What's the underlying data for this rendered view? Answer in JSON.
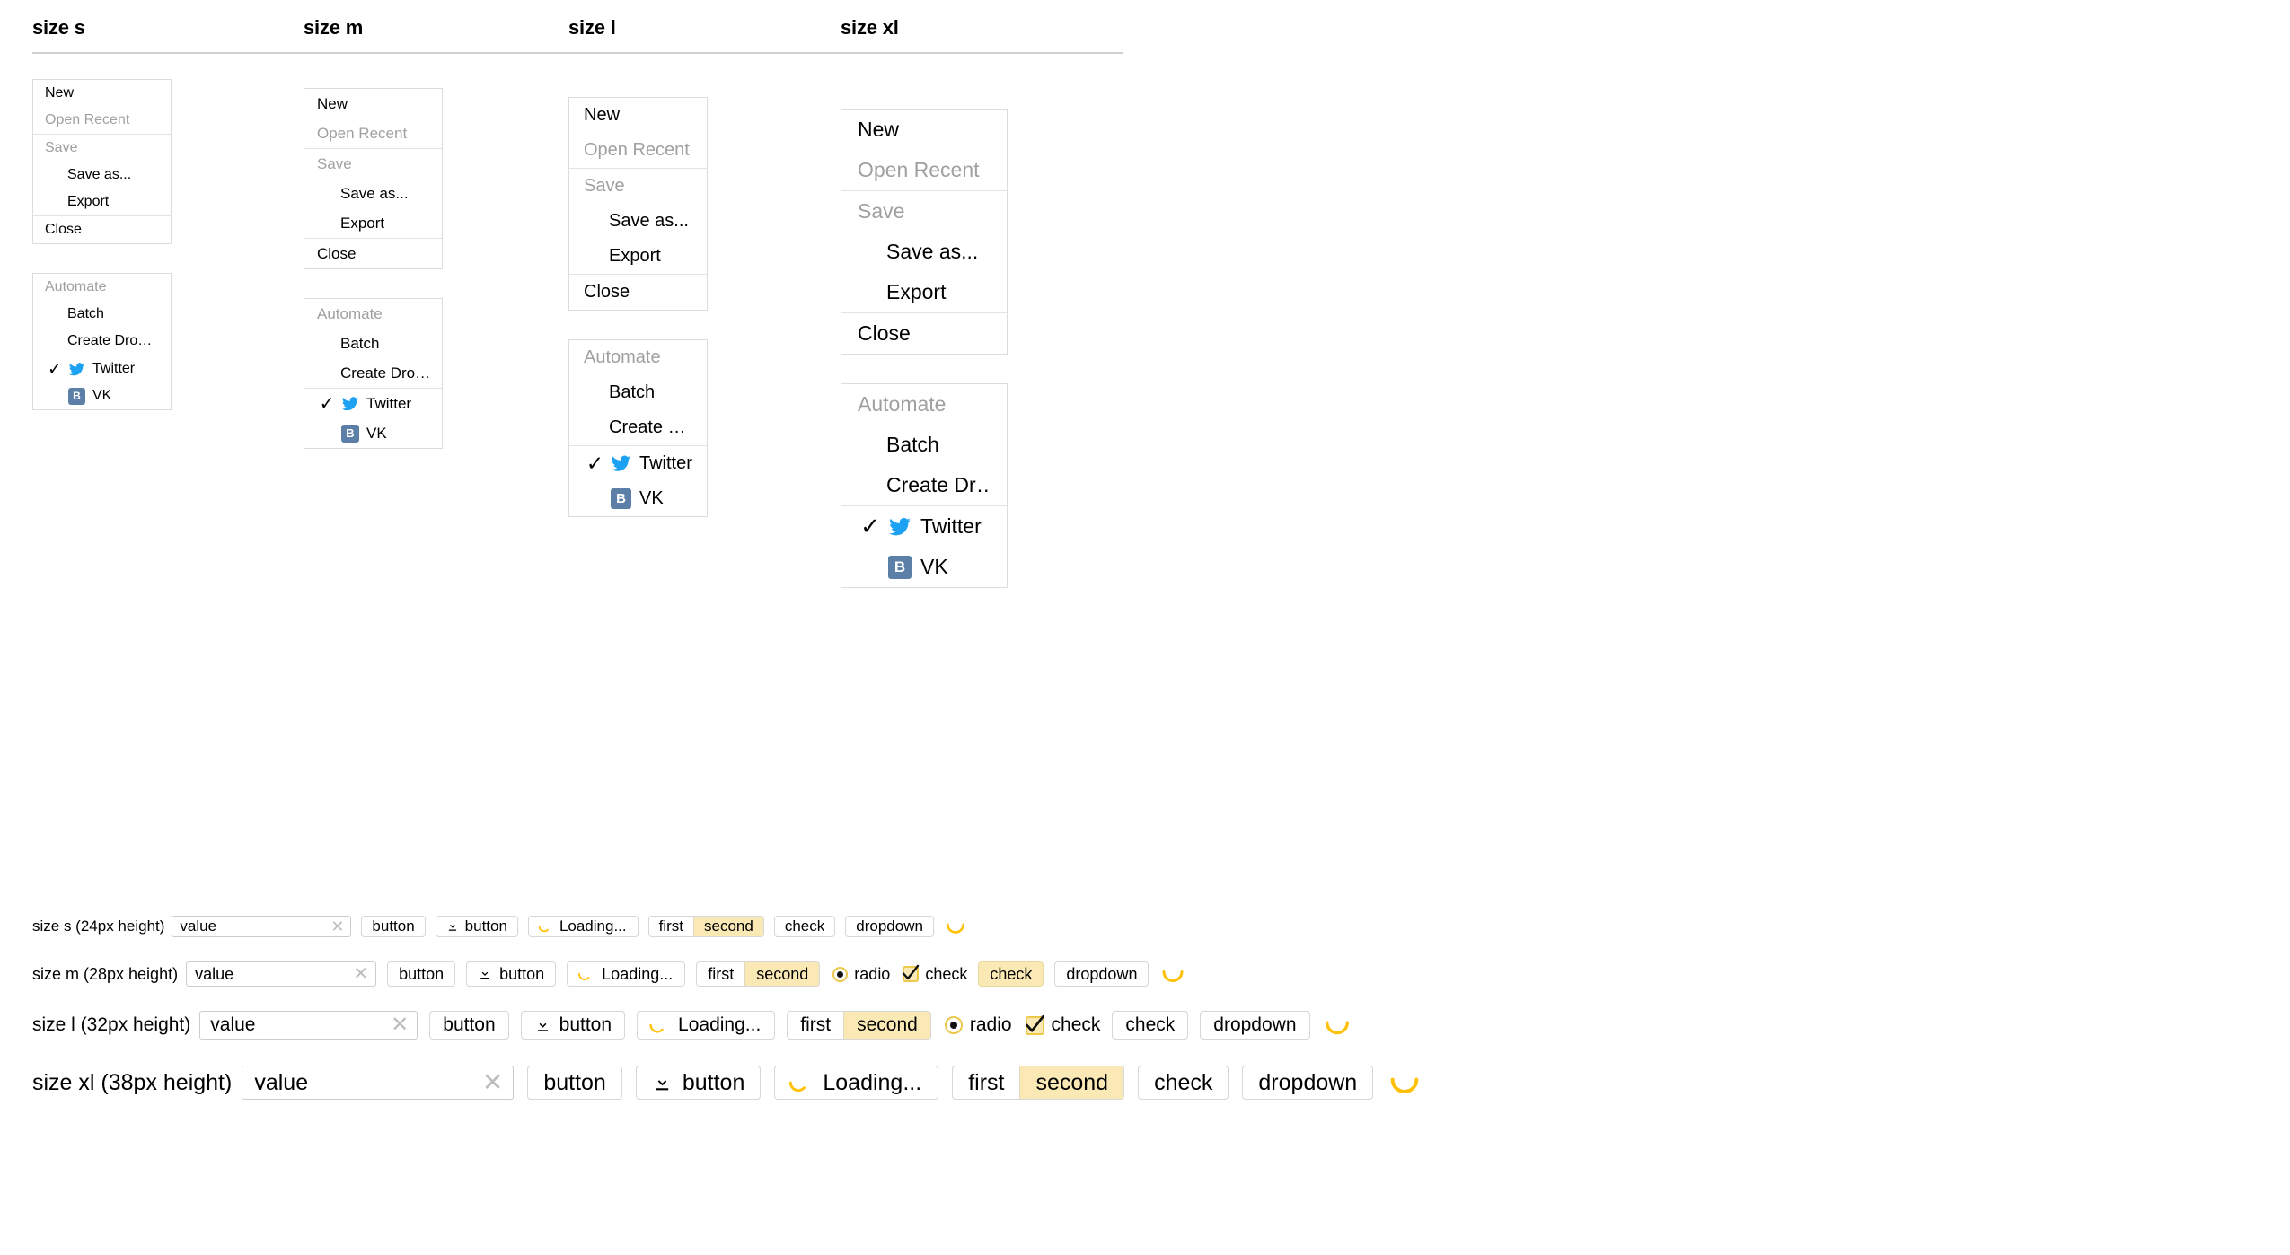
{
  "headers": [
    {
      "label": "size s"
    },
    {
      "label": "size m"
    },
    {
      "label": "size l"
    },
    {
      "label": "size xl"
    }
  ],
  "colors": {
    "accent_yellow": "#fae9b4",
    "accent_border": "#ecc94b",
    "spinner": "#ffc107",
    "twitter_blue": "#1da1f2",
    "vk_blue": "#5b7fa6",
    "muted_text": "#a0a0a0",
    "border_grey": "#dcdcdc"
  },
  "menus": {
    "file_group_1": [
      {
        "label": "New",
        "state": "normal",
        "indent": 0
      },
      {
        "label": "Open Recent",
        "state": "muted",
        "indent": 0
      }
    ],
    "file_group_2": [
      {
        "label": "Save",
        "state": "muted",
        "indent": 0
      },
      {
        "label": "Save as...",
        "state": "normal",
        "indent": 1
      },
      {
        "label": "Export",
        "state": "normal",
        "indent": 1
      }
    ],
    "file_group_3": [
      {
        "label": "Close",
        "state": "normal",
        "indent": 0
      }
    ],
    "automate_group_s": [
      {
        "label": "Automate",
        "state": "muted",
        "indent": 0
      },
      {
        "label": "Batch",
        "state": "normal",
        "indent": 1
      },
      {
        "label": "Create Dro…",
        "state": "normal",
        "indent": 1
      }
    ],
    "automate_group_m": [
      {
        "label": "Automate",
        "state": "muted",
        "indent": 0
      },
      {
        "label": "Batch",
        "state": "normal",
        "indent": 1
      },
      {
        "label": "Create Dro…",
        "state": "normal",
        "indent": 1
      }
    ],
    "automate_group_l": [
      {
        "label": "Automate",
        "state": "muted",
        "indent": 0
      },
      {
        "label": "Batch",
        "state": "normal",
        "indent": 1
      },
      {
        "label": "Create …",
        "state": "normal",
        "indent": 1
      }
    ],
    "automate_group_xl": [
      {
        "label": "Automate",
        "state": "muted",
        "indent": 0
      },
      {
        "label": "Batch",
        "state": "normal",
        "indent": 1
      },
      {
        "label": "Create Dr…",
        "state": "normal",
        "indent": 1
      }
    ],
    "social_group": [
      {
        "label": "Twitter",
        "icon": "twitter-icon",
        "checked": true
      },
      {
        "label": "VK",
        "icon": "vk-icon",
        "checked": false,
        "badge_text": "B"
      }
    ]
  },
  "control_rows": [
    {
      "id": "s",
      "label": "size s (24px height)",
      "input": {
        "value": "value",
        "placeholder": "value"
      },
      "button": "button",
      "icon_button": {
        "label": "button",
        "icon": "download-icon"
      },
      "loading_button": {
        "label": "Loading...",
        "icon": "spinner-icon"
      },
      "segmented": {
        "options": [
          "first",
          "second"
        ],
        "selected": "second"
      },
      "radio": null,
      "inline_check": null,
      "check_button": {
        "label": "check",
        "active": false
      },
      "dropdown": "dropdown",
      "trailing_spinner": true
    },
    {
      "id": "m",
      "label": "size m (28px height)",
      "input": {
        "value": "value",
        "placeholder": "value"
      },
      "button": "button",
      "icon_button": {
        "label": "button",
        "icon": "download-icon"
      },
      "loading_button": {
        "label": "Loading...",
        "icon": "spinner-icon"
      },
      "segmented": {
        "options": [
          "first",
          "second"
        ],
        "selected": "second"
      },
      "radio": {
        "label": "radio",
        "checked": true
      },
      "inline_check": {
        "label": "check",
        "checked": true
      },
      "check_button": {
        "label": "check",
        "active": true
      },
      "dropdown": "dropdown",
      "trailing_spinner": true
    },
    {
      "id": "l",
      "label": "size l (32px height)",
      "input": {
        "value": "value",
        "placeholder": "value"
      },
      "button": "button",
      "icon_button": {
        "label": "button",
        "icon": "download-icon"
      },
      "loading_button": {
        "label": "Loading...",
        "icon": "spinner-icon"
      },
      "segmented": {
        "options": [
          "first",
          "second"
        ],
        "selected": "second"
      },
      "radio": {
        "label": "radio",
        "checked": true
      },
      "inline_check": {
        "label": "check",
        "checked": true
      },
      "check_button": {
        "label": "check",
        "active": false
      },
      "dropdown": "dropdown",
      "trailing_spinner": true
    },
    {
      "id": "xl",
      "label": "size xl (38px height)",
      "input": {
        "value": "value",
        "placeholder": "value"
      },
      "button": "button",
      "icon_button": {
        "label": "button",
        "icon": "download-icon"
      },
      "loading_button": {
        "label": "Loading...",
        "icon": "spinner-icon"
      },
      "segmented": {
        "options": [
          "first",
          "second"
        ],
        "selected": "second"
      },
      "radio": null,
      "inline_check": null,
      "check_button": {
        "label": "check",
        "active": false
      },
      "dropdown": "dropdown",
      "trailing_spinner": true
    }
  ]
}
